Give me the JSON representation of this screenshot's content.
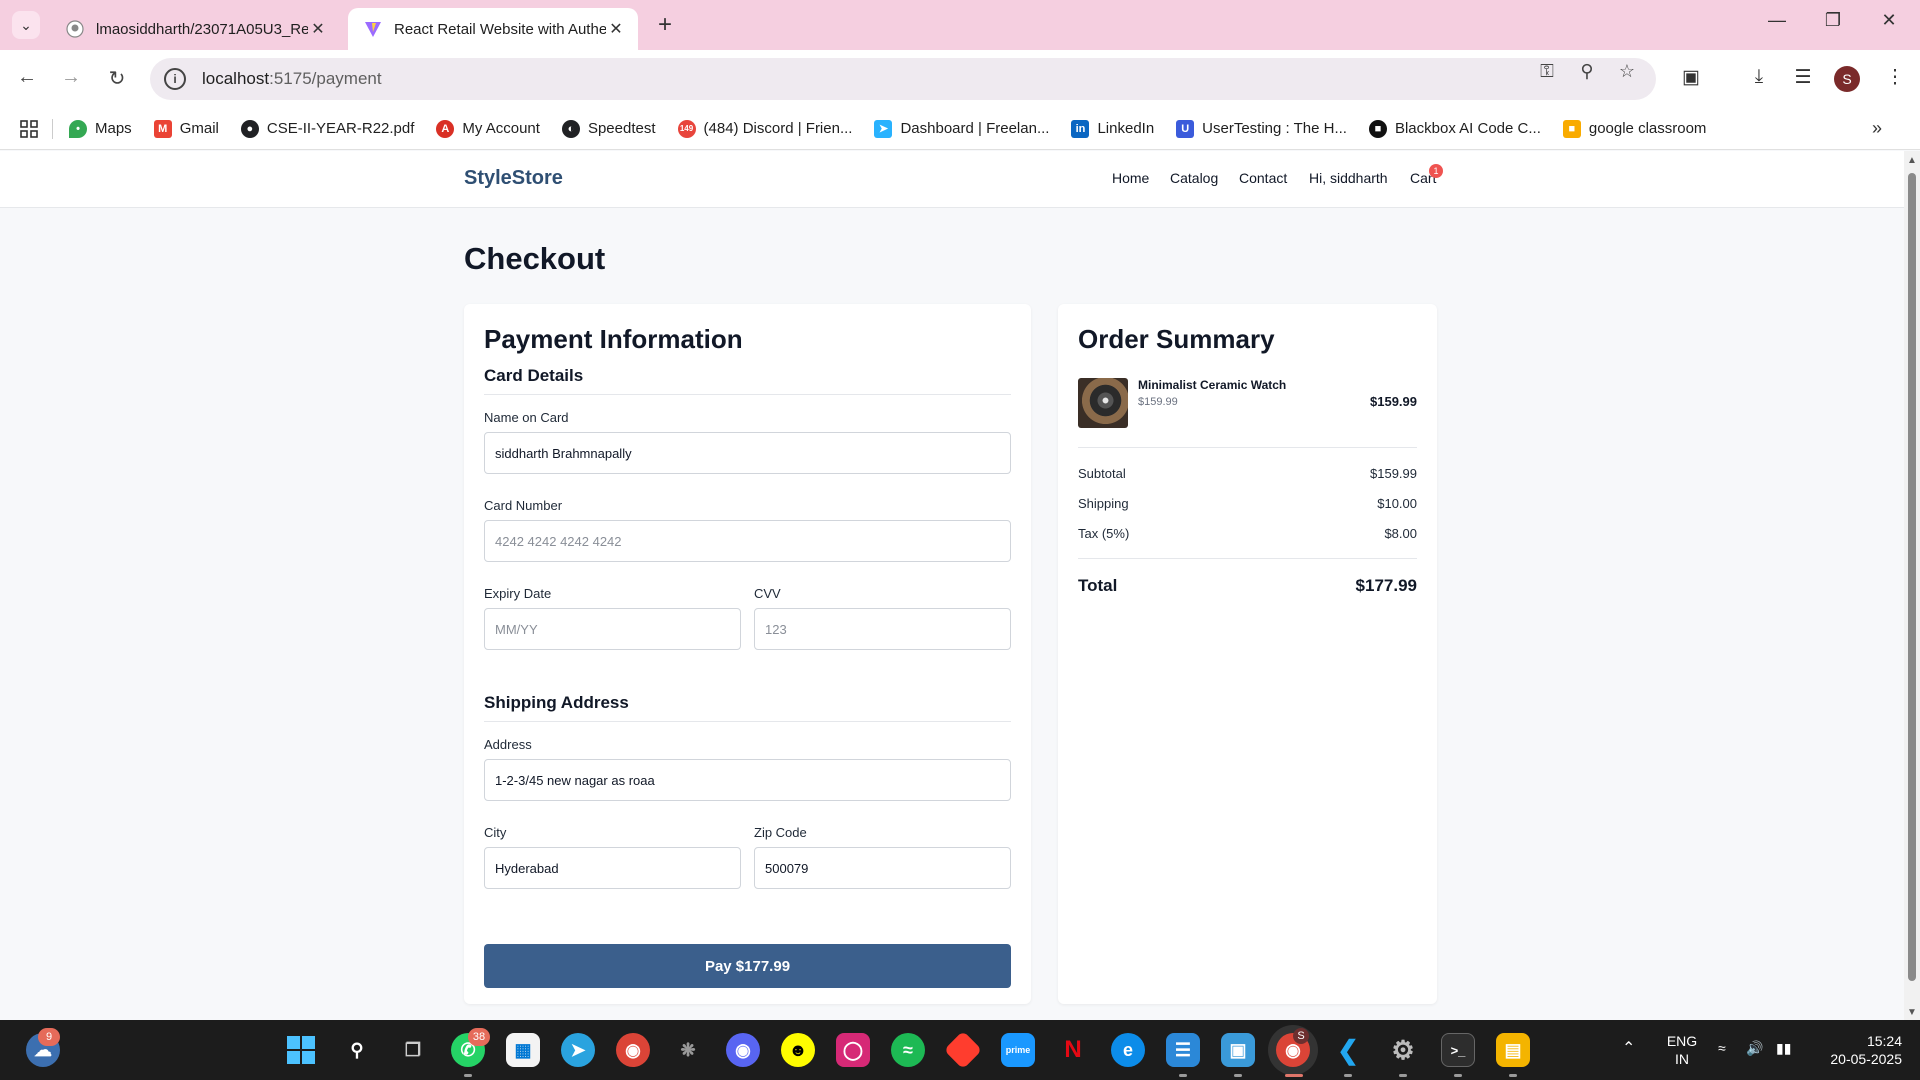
{
  "browser": {
    "tabs": [
      {
        "title": "lmaosiddharth/23071A05U3_Re",
        "active": false
      },
      {
        "title": "React Retail Website with Authe",
        "active": true
      }
    ],
    "url_host": "localhost",
    "url_path": ":5175/payment",
    "profile_initial": "S",
    "bookmarks": [
      {
        "label": "Maps",
        "icon": "maps-pin-icon",
        "color": "#34a853"
      },
      {
        "label": "Gmail",
        "icon": "gmail-icon",
        "color": "#ea4335"
      },
      {
        "label": "CSE-II-YEAR-R22.pdf",
        "icon": "globe-icon",
        "color": "#202124"
      },
      {
        "label": "My Account",
        "icon": "account-icon",
        "color": "#d93025"
      },
      {
        "label": "Speedtest",
        "icon": "speedtest-icon",
        "color": "#202124"
      },
      {
        "label": "(484) Discord | Frien...",
        "icon": "discord-icon",
        "color": "#e8453c"
      },
      {
        "label": "Dashboard | Freelan...",
        "icon": "freelancer-icon",
        "color": "#29b2fe"
      },
      {
        "label": "LinkedIn",
        "icon": "linkedin-icon",
        "color": "#0a66c2"
      },
      {
        "label": "UserTesting : The H...",
        "icon": "usertesting-icon",
        "color": "#3b5bdb"
      },
      {
        "label": "Blackbox AI Code C...",
        "icon": "blackbox-icon",
        "color": "#111111"
      },
      {
        "label": "google classroom",
        "icon": "classroom-icon",
        "color": "#f9ab00"
      }
    ]
  },
  "site": {
    "logo": "StyleStore",
    "nav": {
      "home": "Home",
      "catalog": "Catalog",
      "contact": "Contact",
      "greeting": "Hi, siddharth",
      "cart": "Cart",
      "cart_count": "1"
    },
    "brand_color": "#2f4f73",
    "button_color": "#3b5f8c"
  },
  "checkout": {
    "title": "Checkout",
    "payment": {
      "heading": "Payment Information",
      "card_section": "Card Details",
      "name_label": "Name on Card",
      "name_value": "siddharth Brahmnapally",
      "number_label": "Card Number",
      "number_placeholder": "4242 4242 4242 4242",
      "expiry_label": "Expiry Date",
      "expiry_placeholder": "MM/YY",
      "cvv_label": "CVV",
      "cvv_placeholder": "123",
      "shipping_section": "Shipping Address",
      "address_label": "Address",
      "address_value": "1-2-3/45 new nagar as roaa",
      "city_label": "City",
      "city_value": "Hyderabad",
      "zip_label": "Zip Code",
      "zip_value": "500079",
      "pay_button": "Pay $177.99"
    },
    "summary": {
      "heading": "Order Summary",
      "item_name": "Minimalist Ceramic Watch",
      "item_unit_price": "$159.99",
      "item_total": "$159.99",
      "subtotal_label": "Subtotal",
      "subtotal_value": "$159.99",
      "shipping_label": "Shipping",
      "shipping_value": "$10.00",
      "tax_label": "Tax (5%)",
      "tax_value": "$8.00",
      "total_label": "Total",
      "total_value": "$177.99"
    }
  },
  "taskbar": {
    "weather_badge": "9",
    "whatsapp_badge": "38",
    "chrome_profile_badge": "S",
    "lang_line1": "ENG",
    "lang_line2": "IN",
    "time": "15:24",
    "date": "20-05-2025"
  }
}
